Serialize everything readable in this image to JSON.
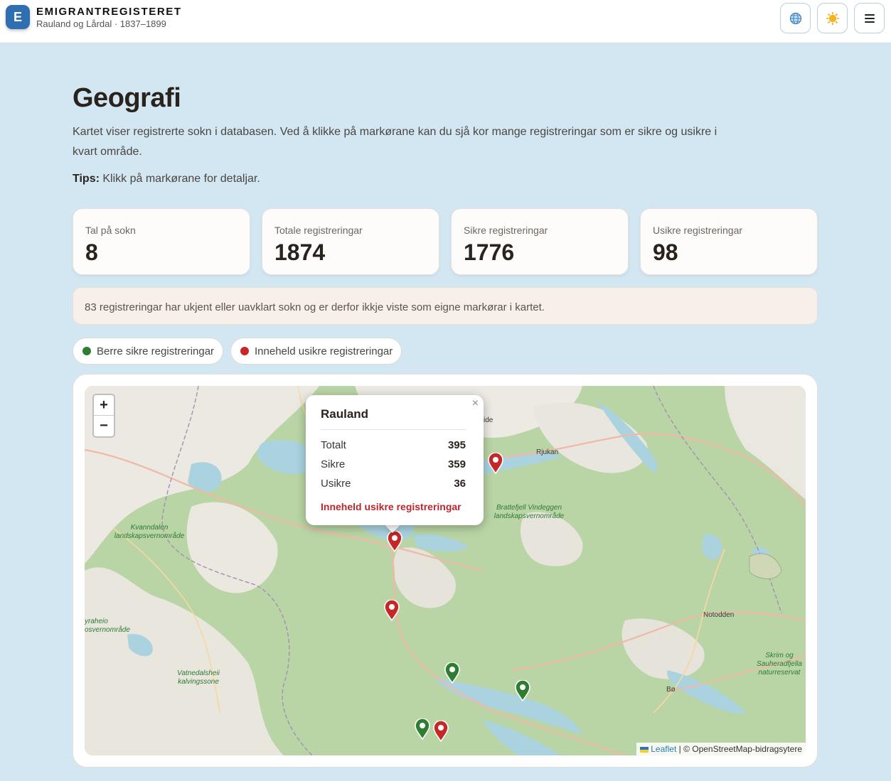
{
  "header": {
    "logo_letter": "E",
    "title": "EMIGRANTREGISTERET",
    "subtitle": "Rauland og Lårdal · 1837–1899",
    "buttons": [
      {
        "name": "language",
        "icon": "globe-icon",
        "glyph": "🌐"
      },
      {
        "name": "theme",
        "icon": "sun-icon",
        "glyph": "☀"
      },
      {
        "name": "menu",
        "icon": "hamburger-menu-icon",
        "glyph": "☰"
      }
    ]
  },
  "page": {
    "title": "Geografi",
    "intro": "Kartet viser registrerte sokn i databasen. Ved å klikke på markørane kan du sjå kor mange registreringar som er sikre og usikre i kvart område.",
    "tips_label": "Tips:",
    "tips_text": " Klikk på markørane for detaljar."
  },
  "stats": [
    {
      "label": "Tal på sokn",
      "value": "8"
    },
    {
      "label": "Totale registreringar",
      "value": "1874"
    },
    {
      "label": "Sikre registreringar",
      "value": "1776"
    },
    {
      "label": "Usikre registreringar",
      "value": "98"
    }
  ],
  "notice": "83 registreringar har ukjent eller uavklart sokn og er derfor ikkje viste som eigne markørar i kartet.",
  "legend": [
    {
      "label": "Berre sikre registreringar",
      "color": "#2e7d32"
    },
    {
      "label": "Inneheld usikre registreringar",
      "color": "#c62828"
    }
  ],
  "map": {
    "zoom_in": "+",
    "zoom_out": "−",
    "popup": {
      "title": "Rauland",
      "close": "×",
      "rows": [
        {
          "label": "Totalt",
          "value": "395"
        },
        {
          "label": "Sikre",
          "value": "359"
        },
        {
          "label": "Usikre",
          "value": "36"
        }
      ],
      "status": "Inneheld usikre registreringar"
    },
    "markers": [
      {
        "status": "uncertain"
      },
      {
        "status": "uncertain"
      },
      {
        "status": "uncertain"
      },
      {
        "status": "certain"
      },
      {
        "status": "certain"
      },
      {
        "status": "certain"
      },
      {
        "status": "uncertain"
      }
    ],
    "place_labels": [
      "Rjukan",
      "Notodden",
      "Bø",
      "ide"
    ],
    "park_labels": [
      "Brattefjell Vindeggen landskapsvernområde",
      "Kvanndalen landskapsvernområde",
      "yraheio osvernområde",
      "Vatnedalsheii kalvingssone",
      "Skrim og Sauheradfjella naturreservat"
    ],
    "attribution_leaflet": "Leaflet",
    "attribution_rest": " | © OpenStreetMap-bidragsytere"
  }
}
